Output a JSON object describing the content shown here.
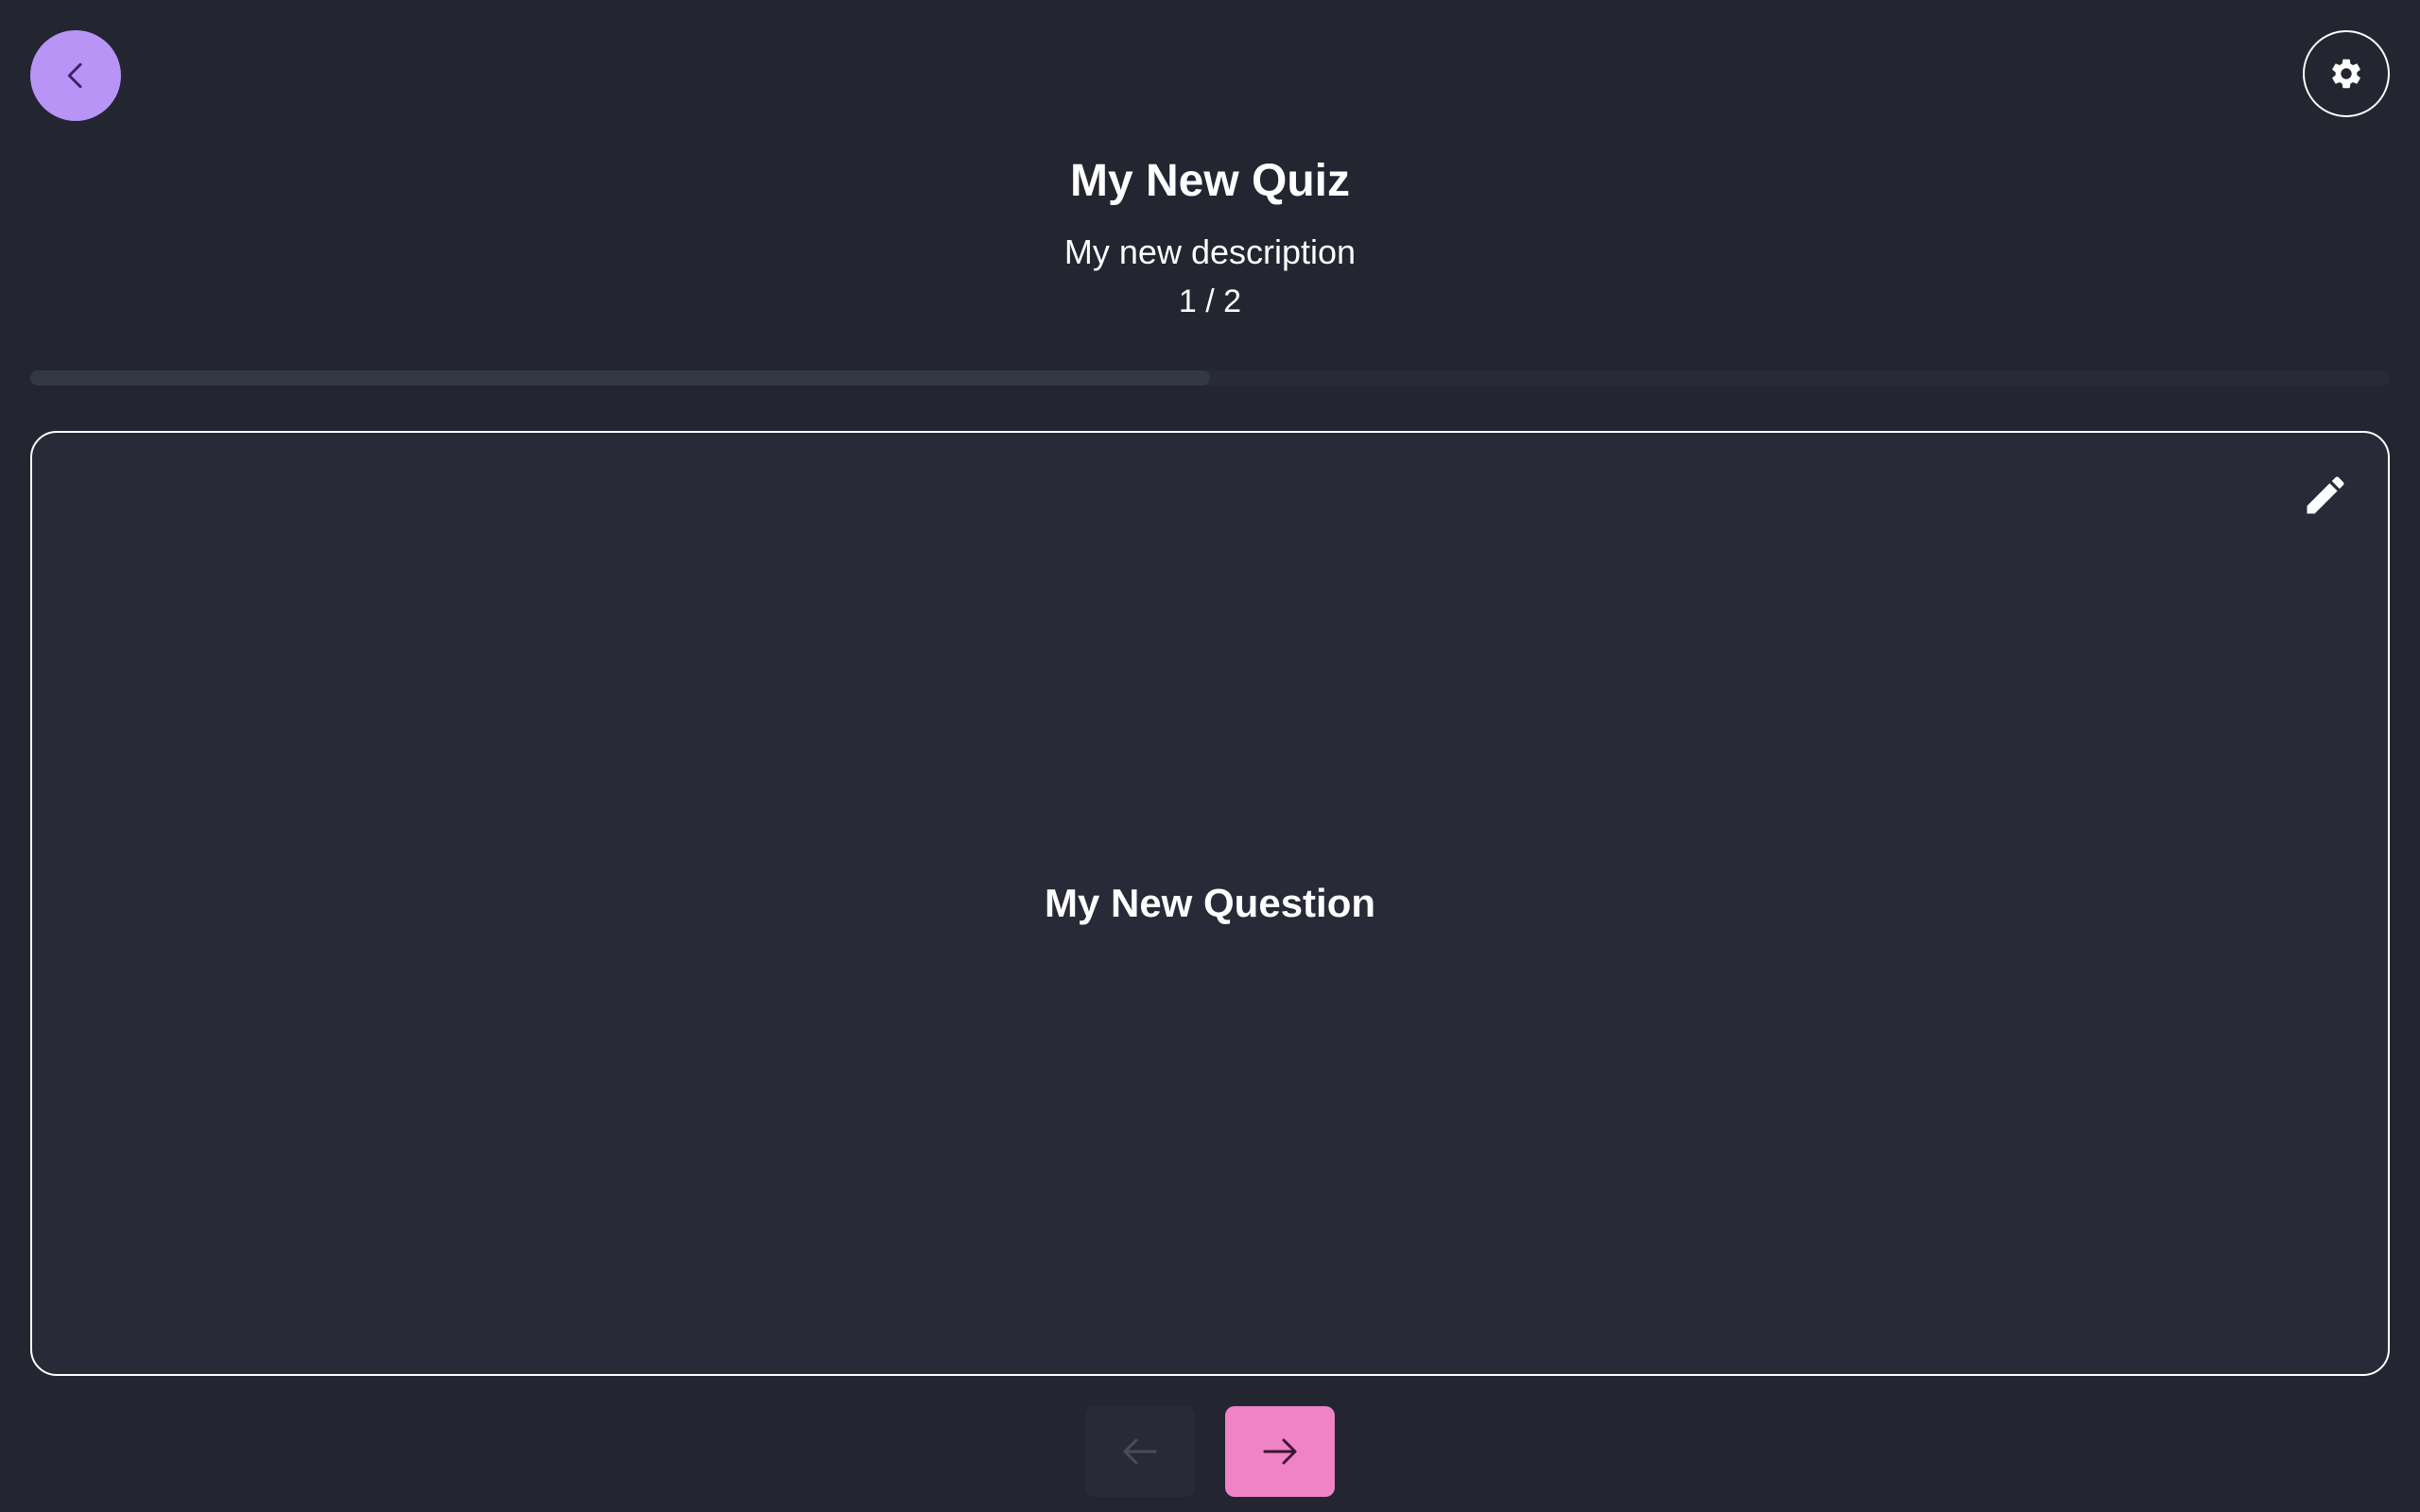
{
  "quiz": {
    "title": "My New Quiz",
    "description": "My new description",
    "progress_text": "1 / 2",
    "progress_fraction": 0.5
  },
  "question": {
    "text": "My New Question"
  },
  "icons": {
    "back": "chevron-left-icon",
    "settings": "gear-icon",
    "edit": "pencil-icon",
    "previous": "arrow-left-icon",
    "next": "arrow-right-icon"
  },
  "colors": {
    "background": "#232530",
    "accent_back": "#b794f6",
    "accent_next": "#f082c6",
    "card_border": "#ffffff"
  },
  "nav": {
    "previous_disabled": true
  }
}
